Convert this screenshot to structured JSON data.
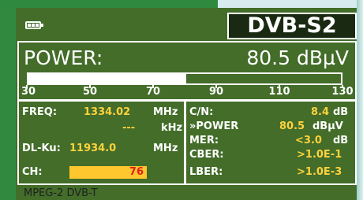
{
  "header": {
    "mode": "DVB-S2",
    "battery": {
      "cells": 3
    }
  },
  "power": {
    "label": "POWER:",
    "value": "80.5 dBµV",
    "level_dbuv": 80.5,
    "scale": [
      "30",
      "50",
      "70",
      "90",
      "110",
      "130"
    ],
    "scale_min": 30,
    "scale_max": 130
  },
  "tuning": {
    "freq_label": "FREQ:",
    "freq_value": "1334.02",
    "freq_unit": "MHz",
    "offset_value": "---",
    "offset_unit": "kHz",
    "dl_label": "DL-Ku:",
    "dl_value": "11934.0",
    "dl_unit": "MHz",
    "ch_label": "CH:",
    "ch_value": "76"
  },
  "measurements": {
    "cn_label": "C/N:",
    "cn_value": "8.4",
    "cn_unit": "dB",
    "power_label": "»POWER",
    "power_value": "80.5",
    "power_unit": "dBµV",
    "mer_label": "MER:",
    "mer_value": "<3.0",
    "mer_unit": "dB",
    "cber_label": "CBER:",
    "cber_value": ">1.0E-1",
    "lber_label": "LBER:",
    "lber_value": ">1.0E-3"
  },
  "footer": {
    "standard": "MPEG-2 DVB-T"
  },
  "colors": {
    "background": "#436d29",
    "value": "#ffd23c",
    "channel_field": "#ffc72e",
    "channel_text": "#e2201c"
  }
}
